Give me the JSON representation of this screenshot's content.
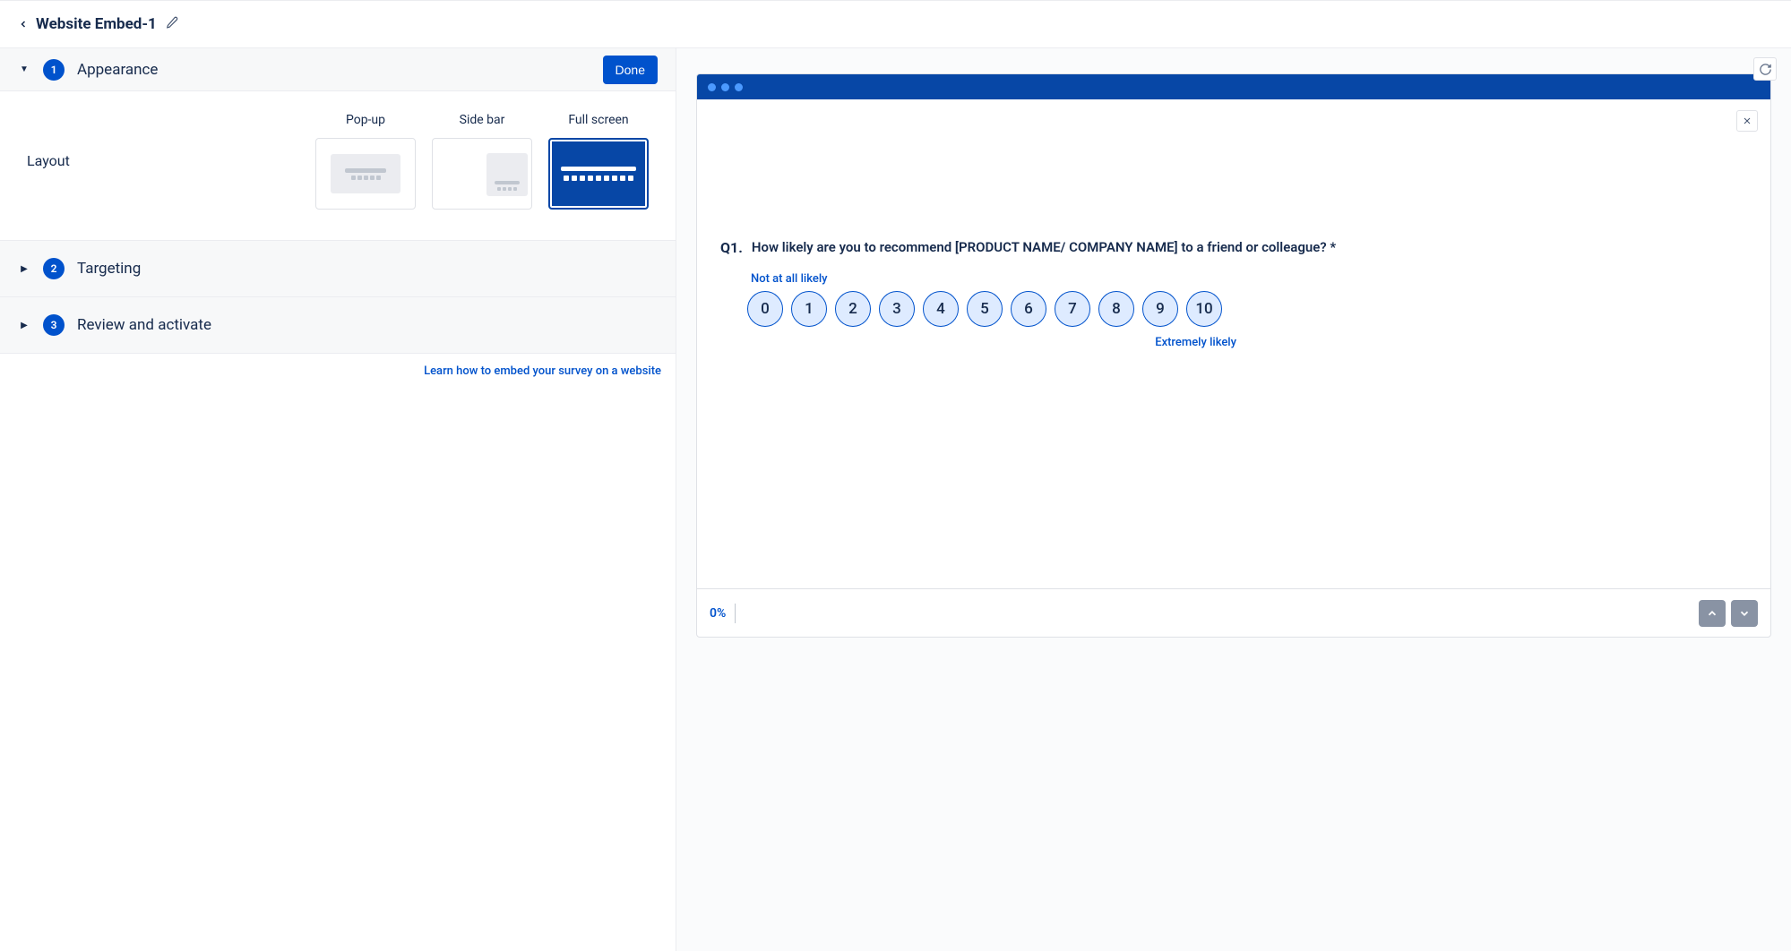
{
  "header": {
    "title": "Website Embed-1"
  },
  "accordion": {
    "appearance": {
      "step": "1",
      "title": "Appearance",
      "done_label": "Done",
      "layout_label": "Layout",
      "options": {
        "popup": "Pop-up",
        "sidebar": "Side bar",
        "fullscreen": "Full screen"
      }
    },
    "targeting": {
      "step": "2",
      "title": "Targeting"
    },
    "review": {
      "step": "3",
      "title": "Review and activate"
    }
  },
  "learn_link": "Learn how to embed your survey on a website",
  "preview": {
    "question_number": "Q1.",
    "question_text": "How likely are you to recommend [PRODUCT NAME/ COMPANY NAME] to a friend or colleague?",
    "asterisk": "*",
    "low_label": "Not at all likely",
    "high_label": "Extremely likely",
    "nps": [
      "0",
      "1",
      "2",
      "3",
      "4",
      "5",
      "6",
      "7",
      "8",
      "9",
      "10"
    ],
    "progress": "0%"
  }
}
